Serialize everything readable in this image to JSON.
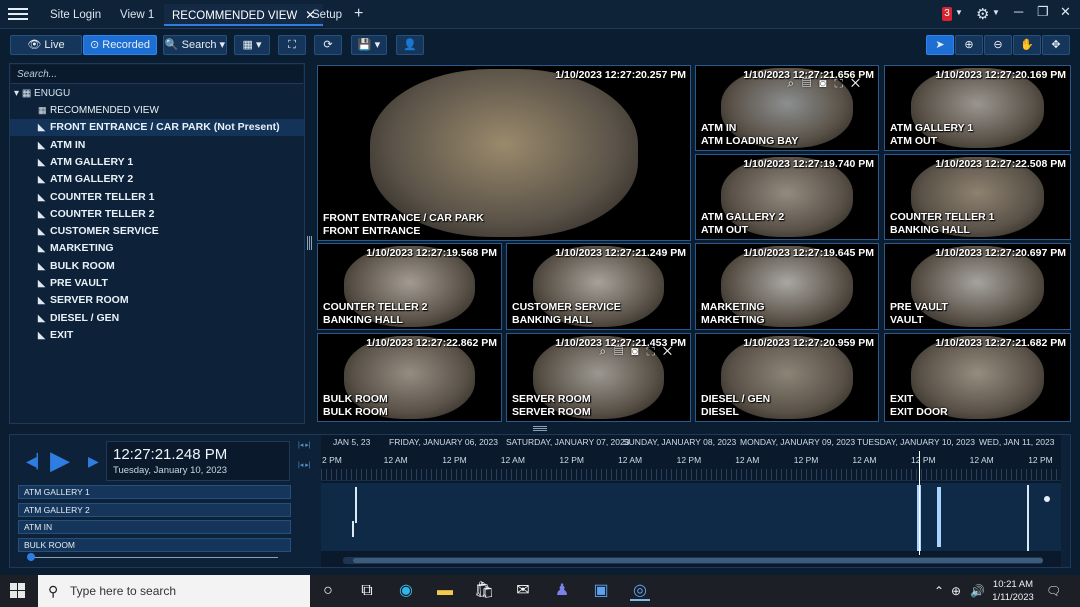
{
  "tabs": [
    {
      "label": "Site Login"
    },
    {
      "label": "View 1"
    },
    {
      "label": "RECOMMENDED VIEW",
      "active": true,
      "closable": true
    },
    {
      "label": "Setup"
    }
  ],
  "titlebar": {
    "alert_count": "3",
    "icons": [
      "hamburger-icon",
      "plus-icon",
      "gear-icon",
      "minimize-icon",
      "restore-icon",
      "close-icon"
    ]
  },
  "toolbar": {
    "live_label": "Live",
    "recorded_label": "Recorded",
    "search_label": "Search",
    "icons": [
      "eye-icon",
      "record-icon",
      "magnifier-icon",
      "layout-icon",
      "fullscreen-icon",
      "refresh-icon",
      "save-icon",
      "user-add-icon",
      "pointer-icon",
      "zoom-in-icon",
      "zoom-out-icon",
      "hand-icon",
      "move-icon"
    ]
  },
  "sidebar": {
    "search_placeholder": "Search...",
    "root": "ENUGU",
    "items": [
      {
        "label": "RECOMMENDED VIEW",
        "type": "view"
      },
      {
        "label": "FRONT ENTRANCE / CAR PARK (Not Present)",
        "type": "camera",
        "selected": true
      },
      {
        "label": "ATM IN",
        "type": "camera"
      },
      {
        "label": "ATM GALLERY 1",
        "type": "camera"
      },
      {
        "label": "ATM GALLERY 2",
        "type": "camera"
      },
      {
        "label": "COUNTER TELLER 1",
        "type": "camera"
      },
      {
        "label": "COUNTER TELLER 2",
        "type": "camera"
      },
      {
        "label": "CUSTOMER SERVICE",
        "type": "camera"
      },
      {
        "label": "MARKETING",
        "type": "camera"
      },
      {
        "label": "BULK ROOM",
        "type": "camera"
      },
      {
        "label": "PRE VAULT",
        "type": "camera"
      },
      {
        "label": "SERVER ROOM",
        "type": "camera"
      },
      {
        "label": "DIESEL / GEN",
        "type": "camera"
      },
      {
        "label": "EXIT",
        "type": "camera"
      }
    ]
  },
  "cameras": [
    {
      "ts": "1/10/2023 12:27:20.257 PM",
      "line1": "FRONT ENTRANCE / CAR PARK",
      "line2": "FRONT ENTRANCE",
      "tone": "#9a8a6c"
    },
    {
      "ts": "1/10/2023 12:27:21.656 PM",
      "line1": "ATM IN",
      "line2": "ATM LOADING BAY",
      "tone": "#8c8f90",
      "controls": true
    },
    {
      "ts": "1/10/2023 12:27:20.169 PM",
      "line1": "ATM GALLERY 1",
      "line2": "ATM OUT",
      "tone": "#9a9590"
    },
    {
      "ts": "1/10/2023 12:27:19.740 PM",
      "line1": "ATM GALLERY 2",
      "line2": "ATM OUT",
      "tone": "#938a80"
    },
    {
      "ts": "1/10/2023 12:27:22.508 PM",
      "line1": "COUNTER TELLER 1",
      "line2": "BANKING HALL",
      "tone": "#8e8170"
    },
    {
      "ts": "1/10/2023 12:27:19.568 PM",
      "line1": "COUNTER TELLER 2",
      "line2": "BANKING HALL",
      "tone": "#a39b92"
    },
    {
      "ts": "1/10/2023 12:27:21.249 PM",
      "line1": "CUSTOMER SERVICE",
      "line2": "BANKING HALL",
      "tone": "#a7a19a"
    },
    {
      "ts": "1/10/2023 12:27:19.645 PM",
      "line1": "MARKETING",
      "line2": "MARKETING",
      "tone": "#a8a7a2"
    },
    {
      "ts": "1/10/2023 12:27:20.697 PM",
      "line1": "PRE VAULT",
      "line2": "VAULT",
      "tone": "#a5a39e"
    },
    {
      "ts": "1/10/2023 12:27:22.862 PM",
      "line1": "BULK ROOM",
      "line2": "BULK ROOM",
      "tone": "#958d82"
    },
    {
      "ts": "1/10/2023 12:27:21.453 PM",
      "line1": "SERVER ROOM",
      "line2": "SERVER ROOM",
      "tone": "#9b9891",
      "controls": true
    },
    {
      "ts": "1/10/2023 12:27:20.959 PM",
      "line1": "DIESEL / GEN",
      "line2": "DIESEL",
      "tone": "#8d8478"
    },
    {
      "ts": "1/10/2023 12:27:21.682 PM",
      "line1": "EXIT",
      "line2": "EXIT DOOR",
      "tone": "#968d80"
    }
  ],
  "playback": {
    "time": "12:27:21.248 PM",
    "date": "Tuesday, January 10, 2023",
    "tracks": [
      "ATM GALLERY 1",
      "ATM GALLERY 2",
      "ATM IN",
      "BULK ROOM"
    ]
  },
  "timeline": {
    "days": [
      "JAN 5, 23",
      "FRIDAY, JANUARY 06, 2023",
      "SATURDAY, JANUARY 07, 2023",
      "SUNDAY, JANUARY 08, 2023",
      "MONDAY, JANUARY 09, 2023",
      "TUESDAY, JANUARY 10, 2023",
      "WED, JAN 11, 2023"
    ],
    "hours": [
      "2 PM",
      "12 AM",
      "12 PM",
      "12 AM",
      "12 PM",
      "12 AM",
      "12 PM",
      "12 AM",
      "12 PM",
      "12 AM",
      "12 PM",
      "12 AM",
      "12 PM"
    ]
  },
  "taskbar": {
    "search_placeholder": "Type here to search",
    "time": "10:21 AM",
    "date": "1/11/2023",
    "apps": [
      "cortana-icon",
      "task-view-icon",
      "edge-icon",
      "file-explorer-icon",
      "store-icon",
      "mail-icon",
      "teams-icon",
      "notes-icon",
      "vms-client-icon"
    ],
    "tray": [
      "chevron-up-icon",
      "globe-icon",
      "speaker-icon",
      "notification-icon"
    ]
  },
  "colors": {
    "accent": "#2f7de1",
    "background": "#0b1d31",
    "alert": "#d8242f"
  }
}
